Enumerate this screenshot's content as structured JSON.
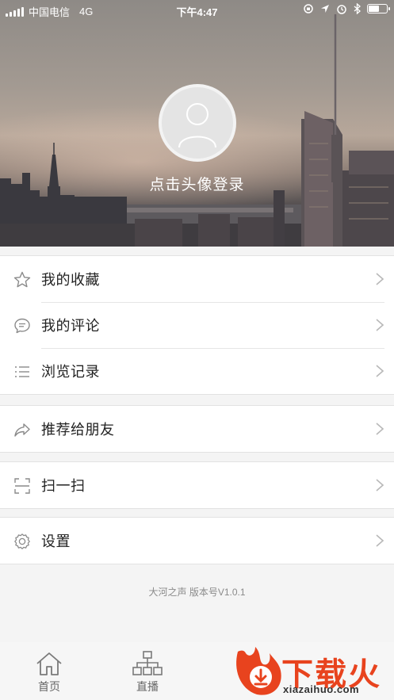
{
  "status_bar": {
    "carrier": "中国电信",
    "network": "4G",
    "time": "下午4:47",
    "battery_level": 0.55
  },
  "profile": {
    "login_prompt": "点击头像登录",
    "avatar_icon": "user-silhouette-icon"
  },
  "menu": {
    "favorites": {
      "label": "我的收藏",
      "icon": "star-icon"
    },
    "comments": {
      "label": "我的评论",
      "icon": "comment-icon"
    },
    "history": {
      "label": "浏览记录",
      "icon": "list-icon"
    },
    "share": {
      "label": "推荐给朋友",
      "icon": "share-icon"
    },
    "scan": {
      "label": "扫一扫",
      "icon": "scan-icon"
    },
    "settings": {
      "label": "设置",
      "icon": "gear-icon"
    }
  },
  "version_text": "大河之声  版本号V1.0.1",
  "tabbar": {
    "tabs": [
      {
        "label": "首页",
        "icon": "home-icon"
      },
      {
        "label": "直播",
        "icon": "org-chart-icon"
      }
    ]
  },
  "watermark": {
    "brand": "下载火",
    "url": "xiazaihuo.com"
  },
  "colors": {
    "watermark_red": "#e8431e",
    "icon_gray": "#8a8a8a",
    "chevron_gray": "#b8b8b8"
  }
}
